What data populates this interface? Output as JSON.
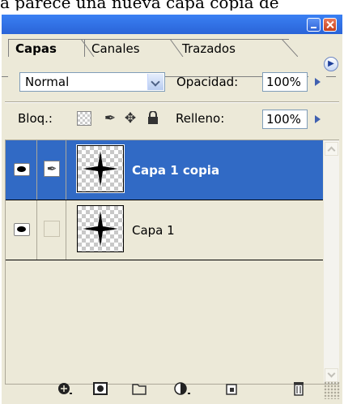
{
  "top_text": "a parece una nueva capa copia de",
  "panel": {
    "tabs": [
      {
        "label": "Capas",
        "active": true
      },
      {
        "label": "Canales",
        "active": false
      },
      {
        "label": "Trazados",
        "active": false
      }
    ],
    "menu_icon": "circle-arrow-right-icon"
  },
  "blend": {
    "mode": "Normal",
    "opacity_label": "Opacidad:",
    "opacity_value": "100%"
  },
  "lock": {
    "label": "Bloq.:",
    "icons": [
      "lock-transparency-icon",
      "lock-brush-icon",
      "lock-move-icon",
      "lock-all-icon"
    ],
    "fill_label": "Relleno:",
    "fill_value": "100%"
  },
  "layers": [
    {
      "name": "Capa 1 copia",
      "selected": true,
      "visible": true,
      "brush": true
    },
    {
      "name": "Capa 1",
      "selected": false,
      "visible": true,
      "brush": false
    }
  ],
  "footer_icons": [
    "link-layers-icon",
    "layer-mask-icon",
    "new-group-icon",
    "adjustment-layer-icon",
    "new-layer-icon",
    "trash-icon"
  ],
  "colors": {
    "selection": "#316ac5",
    "panel_bg": "#ece9d8",
    "title_bar": "#2a64d8"
  }
}
